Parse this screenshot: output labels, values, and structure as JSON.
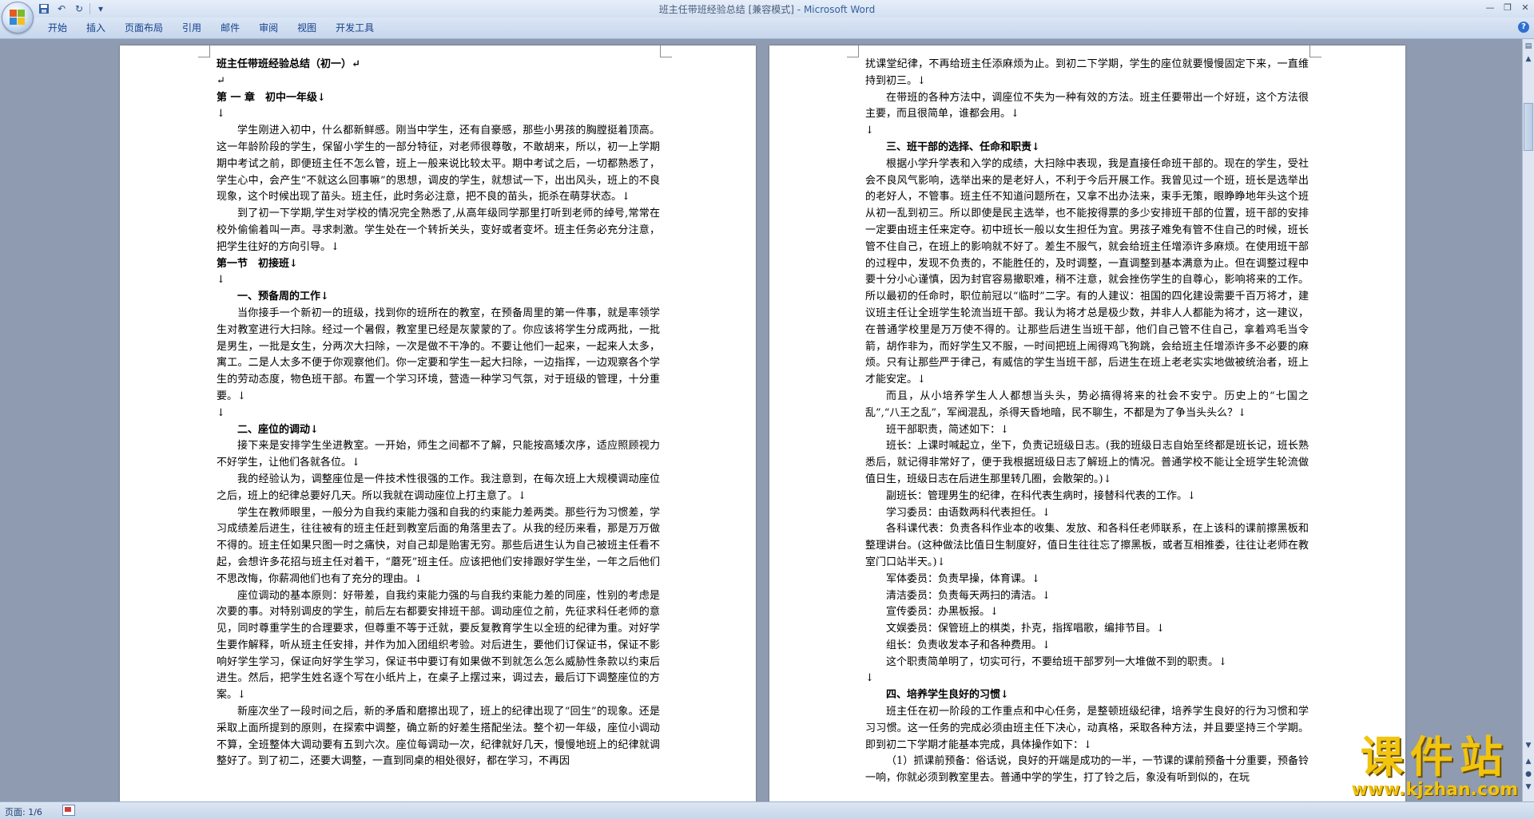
{
  "window": {
    "title_doc": "班主任带班经验总结 [兼容模式]",
    "title_sep": " - ",
    "title_app": "Microsoft Word",
    "minimize": "—",
    "maximize": "❐",
    "close": "✕"
  },
  "quick_access": {
    "save_icon": "save-icon",
    "undo_icon": "undo-icon",
    "redo_icon": "redo-icon",
    "customize_icon": "dropdown-icon"
  },
  "ribbon": {
    "tabs": [
      "开始",
      "插入",
      "页面布局",
      "引用",
      "邮件",
      "审阅",
      "视图",
      "开发工具"
    ],
    "help": "?"
  },
  "status": {
    "page": "页面: 1/6"
  },
  "watermark": {
    "main": "课件站",
    "url": "www.kjzhan.com"
  },
  "page1": {
    "title": "班主任带班经验总结（初一）↵",
    "p_blank1": "↵",
    "chapter": "第 一 章　初中一年级↓",
    "p_blank2": "↓",
    "p1": "学生刚进入初中，什么都新鲜感。刚当中学生，还有自豪感，那些小男孩的胸膛挺着顶高。这一年龄阶段的学生，保留小学生的一部分特征，对老师很尊敬，不敢胡来，所以，初一上学期期中考试之前，即便班主任不怎么管，班上一般来说比较太平。期中考试之后，一切都熟悉了，学生心中，会产生“不就这么回事嘛”的思想，调皮的学生，就想试一下，出出风头，班上的不良现象，这个时候出现了苗头。班主任，此时务必注意，把不良的苗头，扼杀在萌芽状态。↓",
    "p2": "到了初一下学期,学生对学校的情况完全熟悉了,从高年级同学那里打听到老师的绰号,常常在校外偷偷着叫一声。寻求刺激。学生处在一个转折关头，变好或者变坏。班主任务必充分注意，把学生往好的方向引导。↓",
    "section1": "第一节　初接班↓",
    "p_blank3": "↓",
    "h1": "一、预备周的工作↓",
    "p3": "当你接手一个新初一的班级，找到你的班所在的教室，在预备周里的第一件事，就是率领学生对教室进行大扫除。经过一个暑假，教室里已经是灰蒙蒙的了。你应该将学生分成两批，一批是男生，一批是女生，分两次大扫除，一次是做不干净的。不要让他们一起来，一起来人太多，寓工。二是人太多不便于你观察他们。你一定要和学生一起大扫除，一边指挥，一边观察各个学生的劳动态度，物色班干部。布置一个学习环境，营造一种学习气氛，对于班级的管理，十分重要。↓",
    "p_blank4": "↓",
    "h2": "二、座位的调动↓",
    "p4": "接下来是安排学生坐进教室。一开始，师生之间都不了解，只能按高矮次序，适应照顾视力不好学生，让他们各就各位。↓",
    "p5": "我的经验认为，调整座位是一件技术性很强的工作。我注意到，在每次班上大规模调动座位之后，班上的纪律总要好几天。所以我就在调动座位上打主意了。↓",
    "p6": "学生在教师眼里，一般分为自我约束能力强和自我的约束能力差两类。那些行为习惯差，学习成绩差后进生，往往被有的班主任赶到教室后面的角落里去了。从我的经历来看，那是万万做不得的。班主任如果只图一时之痛快，对自己却是贻害无穷。那些后进生认为自己被班主任看不起，会想许多花招与班主任对着干，“蘑死”班主任。应该把他们安排跟好学生坐，一年之后他们不思改悔，你薪凋他们也有了充分的理由。↓",
    "p7": "座位调动的基本原则：好带差，自我约束能力强的与自我约束能力差的同座，性别的考虑是次要的事。对特别调皮的学生，前后左右都要安排班干部。调动座位之前，先征求科任老师的意见，同时尊重学生的合理要求，但尊重不等于迁就，要反复教育学生以全班的纪律为重。对好学生要作解释，听从班主任安排，并作为加入团组织考验。对后进生，要他们订保证书，保证不影响好学生学习，保证向好学生学习，保证书中要订有如果做不到就怎么怎么威胁性条款以约束后进生。然后，把学生姓名逐个写在小纸片上，在桌子上摆过来，调过去，最后订下调整座位的方案。↓",
    "p8": "新座次坐了一段时间之后，新的矛盾和磨擦出现了，班上的纪律出现了“回生”的现象。还是采取上面所提到的原则，在探索中调整，确立新的好差生搭配坐法。整个初一年级，座位小调动不算，全班整体大调动要有五到六次。座位每调动一次，纪律就好几天，慢慢地班上的纪律就调整好了。到了初二，还要大调整，一直到同桌的相处很好，都在学习，不再因"
  },
  "page2": {
    "p1": "扰课堂纪律，不再给班主任添麻烦为止。到初二下学期，学生的座位就要慢慢固定下来，一直维持到初三。↓",
    "p2": "在带班的各种方法中，调座位不失为一种有效的方法。班主任要带出一个好班，这个方法很主要，而且很简单，谁都会用。↓",
    "p_blank1": "↓",
    "h3": "三、班干部的选择、任命和职责↓",
    "p3": "根据小学升学表和入学的成绩，大扫除中表现，我是直接任命班干部的。现在的学生，受社会不良风气影响，选举出来的是老好人，不利于今后开展工作。我曾见过一个班，班长是选举出的老好人，不管事。班主任不知道问题所在，又拿不出办法来，束手无策，眼睁睁地年头这个班从初一乱到初三。所以即使是民主选举，也不能按得票的多少安排班干部的位置，班干部的安排一定要由班主任来定夺。初中班长一般以女生担任为宜。男孩子难免有管不住自己的时候，班长管不住自己，在班上的影响就不好了。差生不服气，就会给班主任增添许多麻烦。在使用班干部的过程中，发现不负责的，不能胜任的，及时调整，一直调整到基本满意为止。但在调整过程中要十分小心谨慎，因为封官容易撤职难，稍不注意，就会挫伤学生的自尊心，影响将来的工作。所以最初的任命时，职位前冠以“临时”二字。有的人建议：祖国的四化建设需要千百万将才，建议班主任让全班学生轮流当班干部。我认为将才总是极少数，并非人人都能为将才，这一建议，在普通学校里是万万使不得的。让那些后进生当班干部，他们自己管不住自己，拿着鸡毛当令箭，胡作非为，而好学生又不服，一时间把班上闹得鸡飞狗跳，会给班主任增添许多不必要的麻烦。只有让那些严于律己，有威信的学生当班干部，后进生在班上老老实实地做被统治者，班上才能安定。↓",
    "p4": "而且，从小培养学生人人都想当头头，势必搞得将来的社会不安宁。历史上的“七国之乱”,“八王之乱”，军阀混乱，杀得天昏地暗，民不聊生，不都是为了争当头头么？↓",
    "p5": "班干部职责，简述如下：↓",
    "p6": "班长：上课时喊起立，坐下，负责记班级日志。(我的班级日志自始至终都是班长记，班长熟悉后，就记得非常好了，便于我根据班级日志了解班上的情况。普通学校不能让全班学生轮流做值日生，班级日志在后进生那里转几圈，会散架的。)↓",
    "p7": "副班长：管理男生的纪律，在科代表生病时，接替科代表的工作。↓",
    "p8": "学习委员：由语数两科代表担任。↓",
    "p9": "各科课代表：负责各科作业本的收集、发放、和各科任老师联系，在上该科的课前擦黑板和整理讲台。(这种做法比值日生制度好，值日生往往忘了擦黑板，或者互相推委，往往让老师在教室门口站半天。)↓",
    "p10": "军体委员：负责早操，体育课。↓",
    "p11": "清洁委员：负责每天两扫的清洁。↓",
    "p12": "宣传委员：办黑板报。↓",
    "p13": "文娱委员：保管班上的棋类，扑克，指挥唱歌，编排节目。↓",
    "p14": "组长：负责收发本子和各种费用。↓",
    "p15": "这个职责简单明了，切实可行，不要给班干部罗列一大堆做不到的职责。↓",
    "p_blank2": "↓",
    "h4": "四、培养学生良好的习惯↓",
    "p16": "班主任在初一阶段的工作重点和中心任务，是整顿班级纪律，培养学生良好的行为习惯和学习习惯。这一任务的完成必须由班主任下决心，动真格，采取各种方法，并且要坚持三个学期。即到初二下学期才能基本完成，具体操作如下：↓",
    "p17": "（1）抓课前预备：俗话说，良好的开端是成功的一半，一节课的课前预备十分重要，预备铃一响，你就必须到教室里去。普通中学的学生，打了铃之后，象没有听到似的，在玩"
  }
}
